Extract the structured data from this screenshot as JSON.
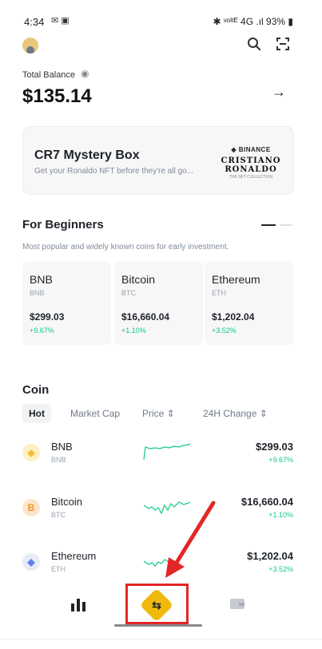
{
  "status_bar": {
    "time": "4:34",
    "right": "✱ ᵛᵒˡᵗᴱ 4G .ıl 93% ▮"
  },
  "header": {
    "avatar": "avatar",
    "search_icon": "search-icon",
    "scan_icon": "scan-icon"
  },
  "balance": {
    "label": "Total Balance",
    "value": "$135.14"
  },
  "promo": {
    "title": "CR7 Mystery Box",
    "subtitle": "Get your Ronaldo NFT before they're all go...",
    "brand": "◈ BINANCE",
    "logo": "CRISTIANO RONALDO",
    "logo_sub": "THE NFT COLLECTION"
  },
  "beginners": {
    "title": "For Beginners",
    "description": "Most popular and widely known coins for early investment.",
    "cards": [
      {
        "name": "BNB",
        "symbol": "BNB",
        "price": "$299.03",
        "change": "+9.67%"
      },
      {
        "name": "Bitcoin",
        "symbol": "BTC",
        "price": "$16,660.04",
        "change": "+1.10%"
      },
      {
        "name": "Ethereum",
        "symbol": "ETH",
        "price": "$1,202.04",
        "change": "+3.52%"
      }
    ]
  },
  "coin": {
    "title": "Coin",
    "tabs": [
      "Hot",
      "Market Cap",
      "Price ⇕",
      "24H Change ⇕"
    ],
    "rows": [
      {
        "name": "BNB",
        "symbol": "BNB",
        "price": "$299.03",
        "change": "+9.67%",
        "icon_color": "#f3ba2f",
        "icon_glyph": "◈"
      },
      {
        "name": "Bitcoin",
        "symbol": "BTC",
        "price": "$16,660.04",
        "change": "+1.10%",
        "icon_color": "#f7931a",
        "icon_glyph": "B"
      },
      {
        "name": "Ethereum",
        "symbol": "ETH",
        "price": "$1,202.04",
        "change": "+3.52%",
        "icon_color": "#627eea",
        "icon_glyph": "◆"
      }
    ]
  },
  "nav": {
    "trade_glyph": "⇆"
  },
  "colors": {
    "accent": "#f0b90b",
    "up": "#0ecb81",
    "highlight": "#e32626"
  }
}
